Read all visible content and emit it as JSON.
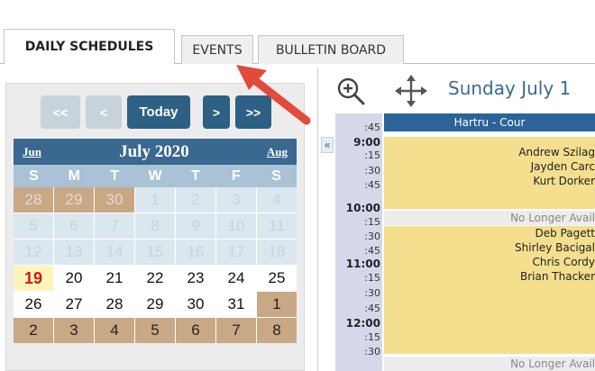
{
  "tabs": {
    "daily": "DAILY SCHEDULES",
    "events": "EVENTS",
    "bulletin": "BULLETIN BOARD"
  },
  "nav": {
    "first": "<<",
    "prev": "<",
    "today": "Today",
    "next": ">",
    "last": ">>"
  },
  "calendar": {
    "prev_month": "Jun",
    "title": "July 2020",
    "next_month": "Aug",
    "dow": [
      "S",
      "M",
      "T",
      "W",
      "T",
      "F",
      "S"
    ],
    "weeks": [
      [
        "28",
        "29",
        "30",
        "1",
        "2",
        "3",
        "4"
      ],
      [
        "5",
        "6",
        "7",
        "8",
        "9",
        "10",
        "11"
      ],
      [
        "12",
        "13",
        "14",
        "15",
        "16",
        "17",
        "18"
      ],
      [
        "19",
        "20",
        "21",
        "22",
        "23",
        "24",
        "25"
      ],
      [
        "26",
        "27",
        "28",
        "29",
        "30",
        "31",
        "1"
      ],
      [
        "2",
        "3",
        "4",
        "5",
        "6",
        "7",
        "8"
      ]
    ]
  },
  "collapse": "«",
  "schedule": {
    "day_title": "Sunday July 1",
    "court": "Hartru - Cour",
    "times": [
      ":45",
      "9:00",
      ":15",
      ":30",
      ":45",
      "10:00",
      ":15",
      ":30",
      ":45",
      "11:00",
      ":15",
      ":30",
      ":45",
      "12:00",
      ":15",
      ":30"
    ],
    "block1_names": [
      "Andrew Szilag",
      "Jayden Carc",
      "Kurt Dorker"
    ],
    "block2_names": [
      "Deb Pagett",
      "Shirley Bacigal",
      "Chris Cordy",
      "Brian Thacker"
    ],
    "no_longer_1": "No Longer Avail",
    "no_longer_2": "No Longer Avail"
  },
  "colors": {
    "accent": "#2e5f84",
    "header": "#3a6891",
    "booked": "#f3df8e",
    "arrow": "#e24a3b"
  }
}
